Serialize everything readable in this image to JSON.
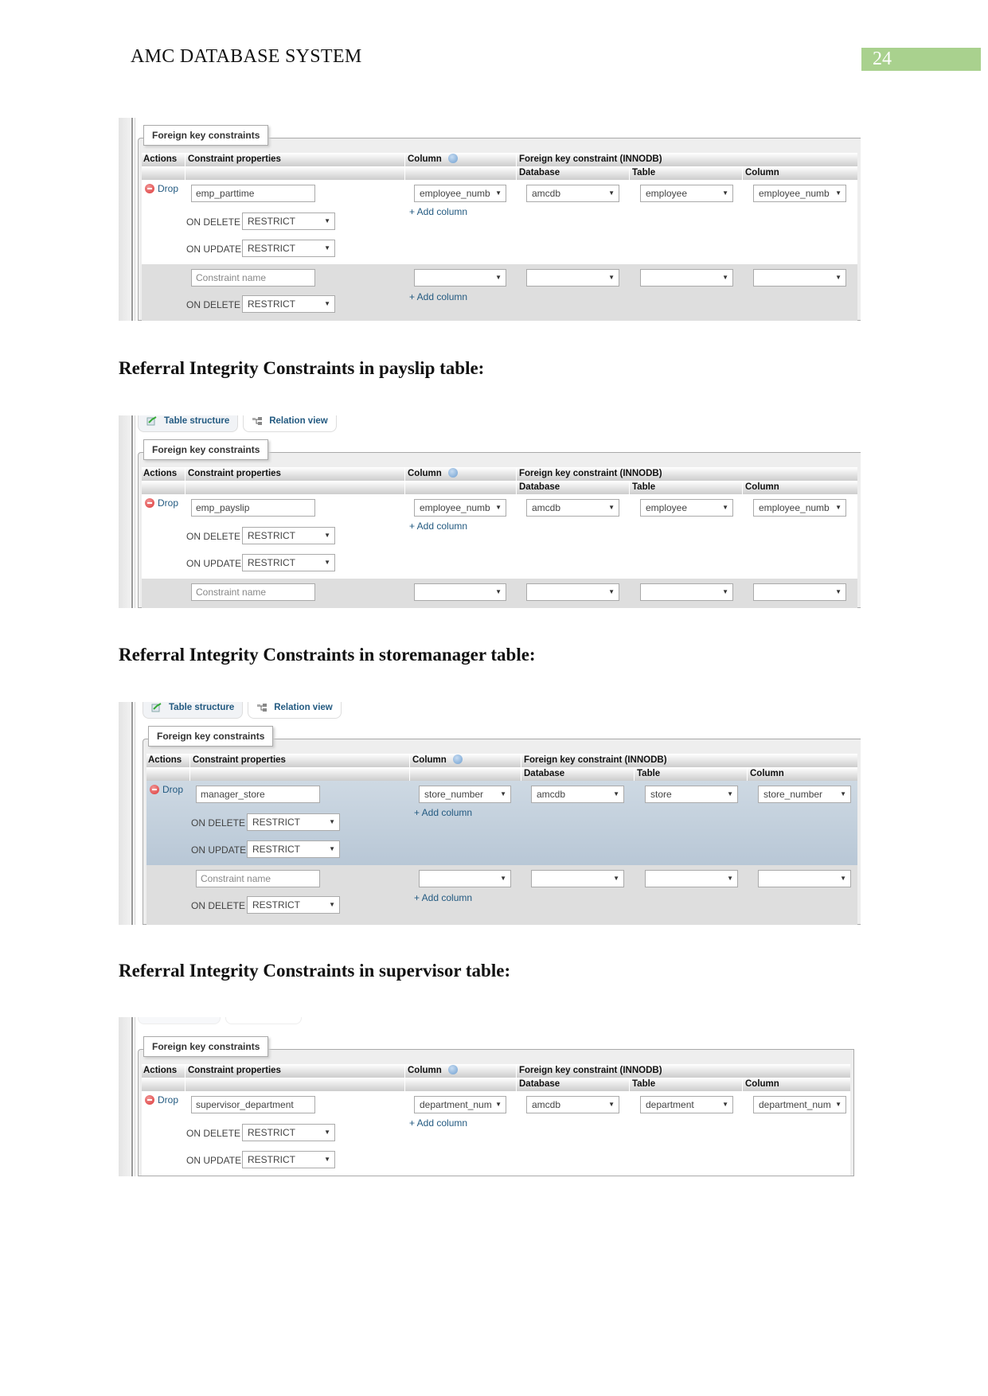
{
  "header": {
    "title": "AMC DATABASE SYSTEM",
    "page_number": "24"
  },
  "headings": [
    "Referral Integrity Constraints in payslip table:",
    "Referral Integrity Constraints in storemanager table:",
    "Referral Integrity Constraints in supervisor table:"
  ],
  "ui": {
    "tab_table_structure": "Table structure",
    "tab_relation_view": "Relation view",
    "legend": "Foreign key constraints",
    "col_actions": "Actions",
    "col_constraint_properties": "Constraint properties",
    "col_column": "Column",
    "col_fk": "Foreign key constraint (INNODB)",
    "col_database": "Database",
    "col_table": "Table",
    "col_ref_column": "Column",
    "drop": "Drop",
    "on_delete": "ON DELETE",
    "on_update": "ON UPDATE",
    "add_column": "+ Add column",
    "constraint_placeholder": "Constraint name",
    "restrict": "RESTRICT"
  },
  "screenshots": [
    {
      "name": "emp_parttime",
      "column": "employee_numb",
      "database": "amcdb",
      "table": "employee",
      "ref_column": "employee_numb",
      "on_delete": "RESTRICT",
      "on_update": "RESTRICT",
      "new_on_delete": "RESTRICT"
    },
    {
      "name": "emp_payslip",
      "column": "employee_numb",
      "database": "amcdb",
      "table": "employee",
      "ref_column": "employee_numb",
      "on_delete": "RESTRICT",
      "on_update": "RESTRICT"
    },
    {
      "name": "manager_store",
      "column": "store_number",
      "database": "amcdb",
      "table": "store",
      "ref_column": "store_number",
      "on_delete": "RESTRICT",
      "on_update": "RESTRICT",
      "new_on_delete": "RESTRICT"
    },
    {
      "name": "supervisor_department",
      "column": "department_num",
      "database": "amcdb",
      "table": "department",
      "ref_column": "department_num",
      "on_delete": "RESTRICT",
      "on_update": "RESTRICT"
    }
  ]
}
